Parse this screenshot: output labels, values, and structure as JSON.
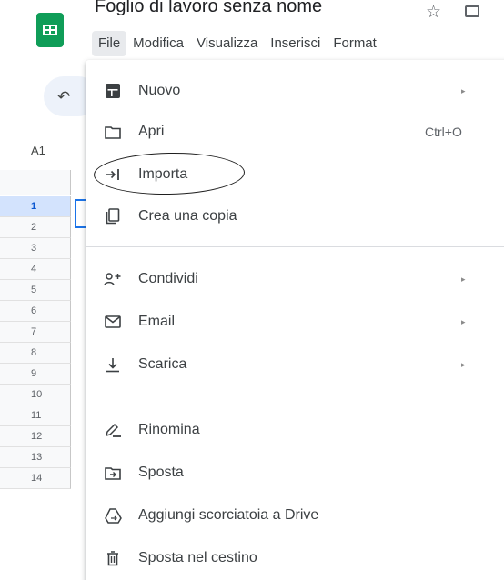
{
  "header": {
    "title": "Foglio di lavoro senza nome",
    "menus": [
      "File",
      "Modifica",
      "Visualizza",
      "Inserisci",
      "Format"
    ],
    "active_menu": "File"
  },
  "toolbar": {
    "name_box": "A1"
  },
  "grid": {
    "rows": [
      "1",
      "2",
      "3",
      "4",
      "5",
      "6",
      "7",
      "8",
      "9",
      "10",
      "11",
      "12",
      "13",
      "14"
    ]
  },
  "file_menu": {
    "items": [
      {
        "label": "Nuovo",
        "icon": "sheet-icon",
        "submenu": "▸"
      },
      {
        "label": "Apri",
        "icon": "folder-icon",
        "shortcut": "Ctrl+O"
      },
      {
        "label": "Importa",
        "icon": "import-icon"
      },
      {
        "label": "Crea una copia",
        "icon": "copy-icon"
      },
      {
        "label": "Condividi",
        "icon": "share-person-icon",
        "submenu": "▸"
      },
      {
        "label": "Email",
        "icon": "email-icon",
        "submenu": "▸"
      },
      {
        "label": "Scarica",
        "icon": "download-icon",
        "submenu": "▸"
      },
      {
        "label": "Rinomina",
        "icon": "rename-pen-icon"
      },
      {
        "label": "Sposta",
        "icon": "move-folder-icon"
      },
      {
        "label": "Aggiungi scorciatoia a Drive",
        "icon": "drive-shortcut-icon"
      },
      {
        "label": "Sposta nel cestino",
        "icon": "trash-icon"
      }
    ]
  },
  "colors": {
    "brand_green": "#0f9d58",
    "selection_blue": "#1a73e8",
    "menu_text": "#3c4043"
  }
}
